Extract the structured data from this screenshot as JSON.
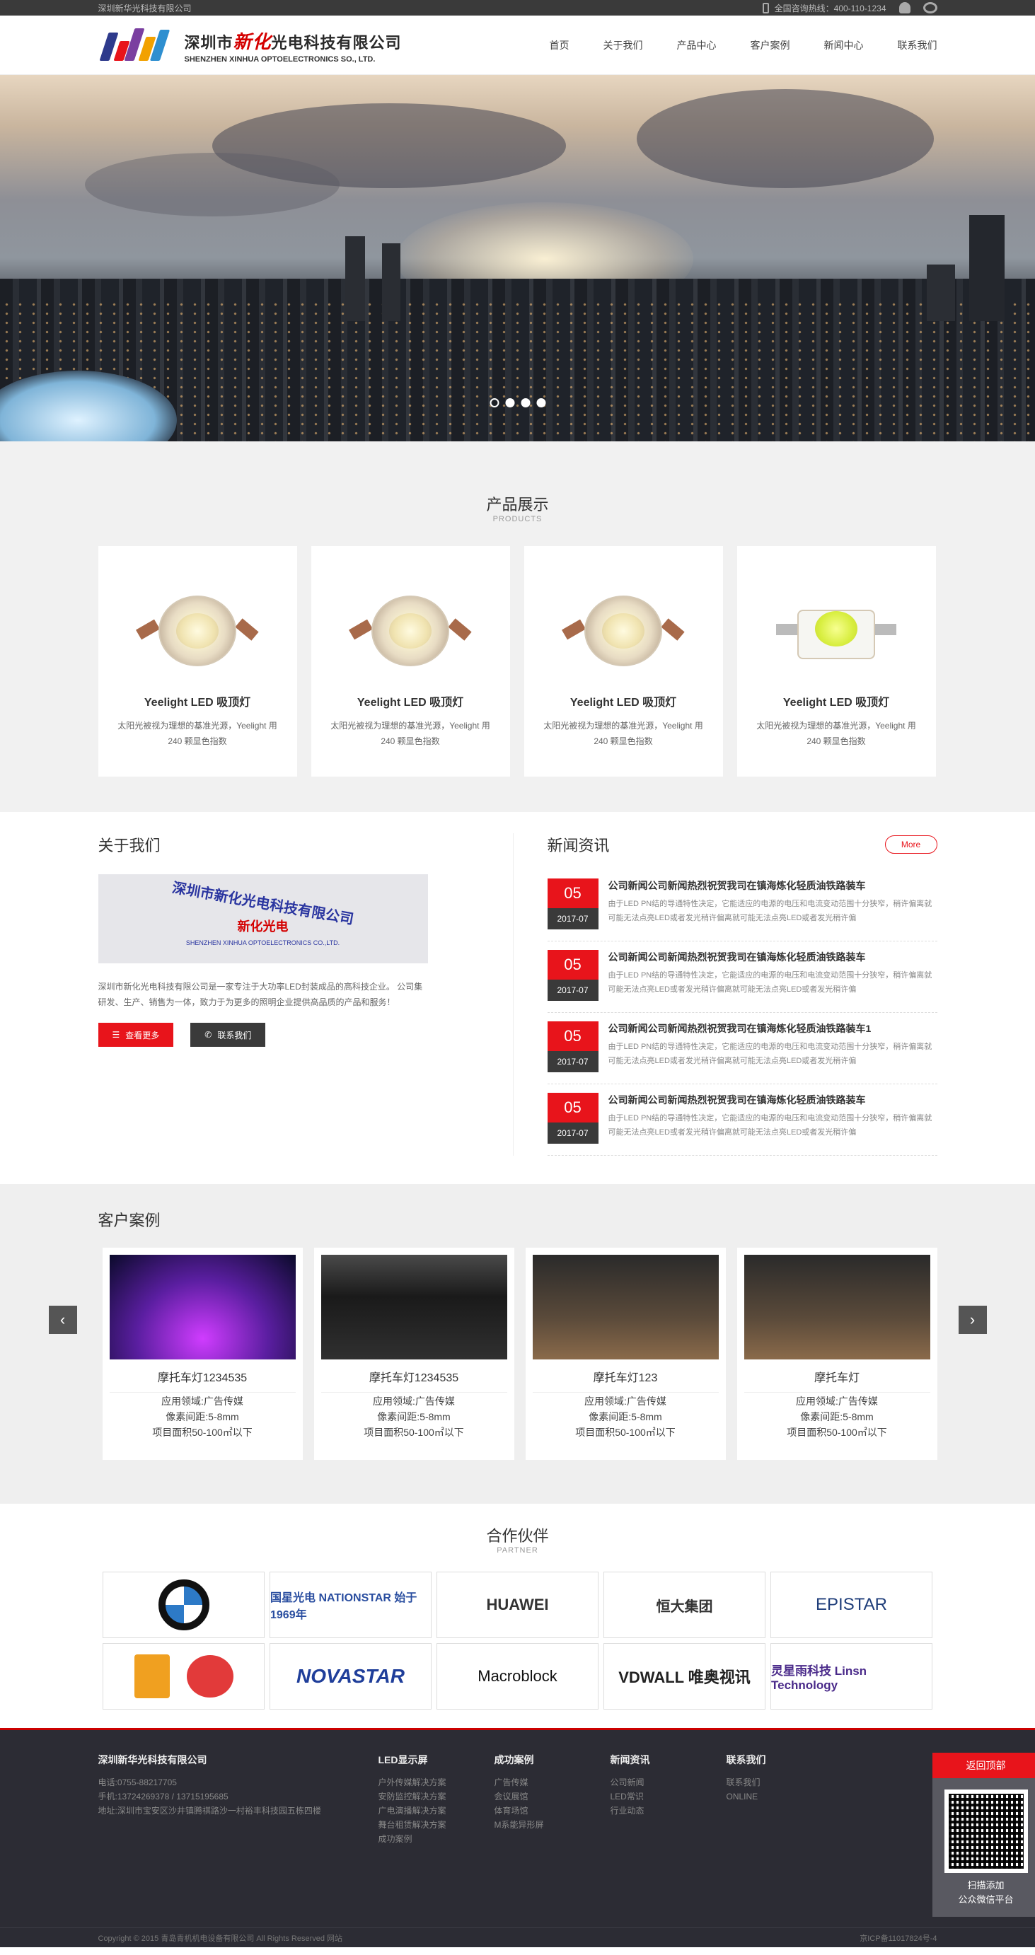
{
  "topbar": {
    "company": "深圳新华光科技有限公司",
    "hotline": "全国咨询热线：400-110-1234"
  },
  "header": {
    "logo_cn_a": "深圳市",
    "logo_cn_b": "新化",
    "logo_cn_c": "光电科技有限公司",
    "logo_en": "SHENZHEN XINHUA OPTOELECTRONICS SO., LTD.",
    "nav": [
      "首页",
      "关于我们",
      "产品中心",
      "客户案例",
      "新闻中心",
      "联系我们"
    ]
  },
  "banner": {
    "slides": 4,
    "active": 1
  },
  "products": {
    "title": "产品展示",
    "subtitle": "PRODUCTS",
    "items": [
      {
        "name": "Yeelight LED 吸顶灯",
        "desc": "太阳光被视为理想的基准光源，Yeelight 用 240 颗显色指数"
      },
      {
        "name": "Yeelight LED 吸顶灯",
        "desc": "太阳光被视为理想的基准光源，Yeelight 用 240 颗显色指数"
      },
      {
        "name": "Yeelight LED 吸顶灯",
        "desc": "太阳光被视为理想的基准光源，Yeelight 用 240 颗显色指数"
      },
      {
        "name": "Yeelight LED 吸顶灯",
        "desc": "太阳光被视为理想的基准光源，Yeelight 用 240 颗显色指数"
      }
    ]
  },
  "about": {
    "title": "关于我们",
    "img_text_1": "深圳市新化光电科技有限公司",
    "img_text_2": "新化光电",
    "img_text_3": "SHENZHEN XINHUA OPTOELECTRONICS CO.,LTD.",
    "text": "深圳市新化光电科技有限公司是一家专注于大功率LED封装成品的高科技企业。 公司集研发、生产、销售为一体，致力于为更多的照明企业提供高品质的产品和服务！",
    "more_btn": "查看更多",
    "contact_btn": "联系我们"
  },
  "news": {
    "title": "新闻资讯",
    "more": "More",
    "items": [
      {
        "day": "05",
        "ym": "2017-07",
        "title": "公司新闻公司新闻热烈祝贺我司在镇海炼化轻质油铁路装车",
        "text": "由于LED PN结的导通特性决定，它能适应的电源的电压和电流变动范围十分狭窄，稍许偏离就可能无法点亮LED或者发光稍许偏离就可能无法点亮LED或者发光稍许偏"
      },
      {
        "day": "05",
        "ym": "2017-07",
        "title": "公司新闻公司新闻热烈祝贺我司在镇海炼化轻质油铁路装车",
        "text": "由于LED PN结的导通特性决定，它能适应的电源的电压和电流变动范围十分狭窄，稍许偏离就可能无法点亮LED或者发光稍许偏离就可能无法点亮LED或者发光稍许偏"
      },
      {
        "day": "05",
        "ym": "2017-07",
        "title": "公司新闻公司新闻热烈祝贺我司在镇海炼化轻质油铁路装车1",
        "text": "由于LED PN结的导通特性决定，它能适应的电源的电压和电流变动范围十分狭窄，稍许偏离就可能无法点亮LED或者发光稍许偏离就可能无法点亮LED或者发光稍许偏"
      },
      {
        "day": "05",
        "ym": "2017-07",
        "title": "公司新闻公司新闻热烈祝贺我司在镇海炼化轻质油铁路装车",
        "text": "由于LED PN结的导通特性决定，它能适应的电源的电压和电流变动范围十分狭窄，稍许偏离就可能无法点亮LED或者发光稍许偏离就可能无法点亮LED或者发光稍许偏"
      }
    ]
  },
  "cases": {
    "title": "客户案例",
    "items": [
      {
        "name": "摩托车灯1234535",
        "l1": "应用领域:广告传媒",
        "l2": "像素间距:5-8mm",
        "l3": "项目面积50-100㎡以下"
      },
      {
        "name": "摩托车灯1234535",
        "l1": "应用领域:广告传媒",
        "l2": "像素间距:5-8mm",
        "l3": "项目面积50-100㎡以下"
      },
      {
        "name": "摩托车灯123",
        "l1": "应用领域:广告传媒",
        "l2": "像素间距:5-8mm",
        "l3": "项目面积50-100㎡以下"
      },
      {
        "name": "摩托车灯",
        "l1": "应用领域:广告传媒",
        "l2": "像素间距:5-8mm",
        "l3": "项目面积50-100㎡以下"
      }
    ]
  },
  "partners": {
    "title": "合作伙伴",
    "subtitle": "PARTNER",
    "logos": [
      "BMW",
      "国星光电 NATIONSTAR 始于1969年",
      "HUAWEI",
      "恒大集团",
      "EPISTAR",
      "",
      "NOVASTAR",
      "Macroblock",
      "VDWALL 唯奥视讯",
      "灵星雨科技 Linsn Technology"
    ]
  },
  "footer": {
    "company": "深圳新华光科技有限公司",
    "tel": "电话:0755-88217705",
    "mobile": "手机:13724269378 / 13715195685",
    "address": "地址:深圳市宝安区沙井镇腾祺路沙一村裕丰科技园五栋四楼",
    "cols": [
      {
        "title": "LED显示屏",
        "items": [
          "户外传媒解决方案",
          "安防监控解决方案",
          "广电演播解决方案",
          "舞台租赁解决方案",
          "成功案例"
        ]
      },
      {
        "title": "成功案例",
        "items": [
          "广告传媒",
          "会议展馆",
          "体育场馆",
          "M系能异形屏"
        ]
      },
      {
        "title": "新闻资讯",
        "items": [
          "公司新闻",
          "LED常识",
          "行业动态"
        ]
      },
      {
        "title": "联系我们",
        "items": [
          "联系我们",
          "ONLINE"
        ]
      }
    ],
    "qr_top": "返回顶部",
    "qr_line1": "扫描添加",
    "qr_line2": "公众微信平台",
    "copyright": "Copyright © 2015 青岛青机机电设备有限公司 All Rights Reserved 网站",
    "icp": "京ICP备11017824号-4"
  },
  "colors": {
    "accent": "#e8141b",
    "dark": "#3a3a3a",
    "footer_bg": "#2c2c34"
  }
}
